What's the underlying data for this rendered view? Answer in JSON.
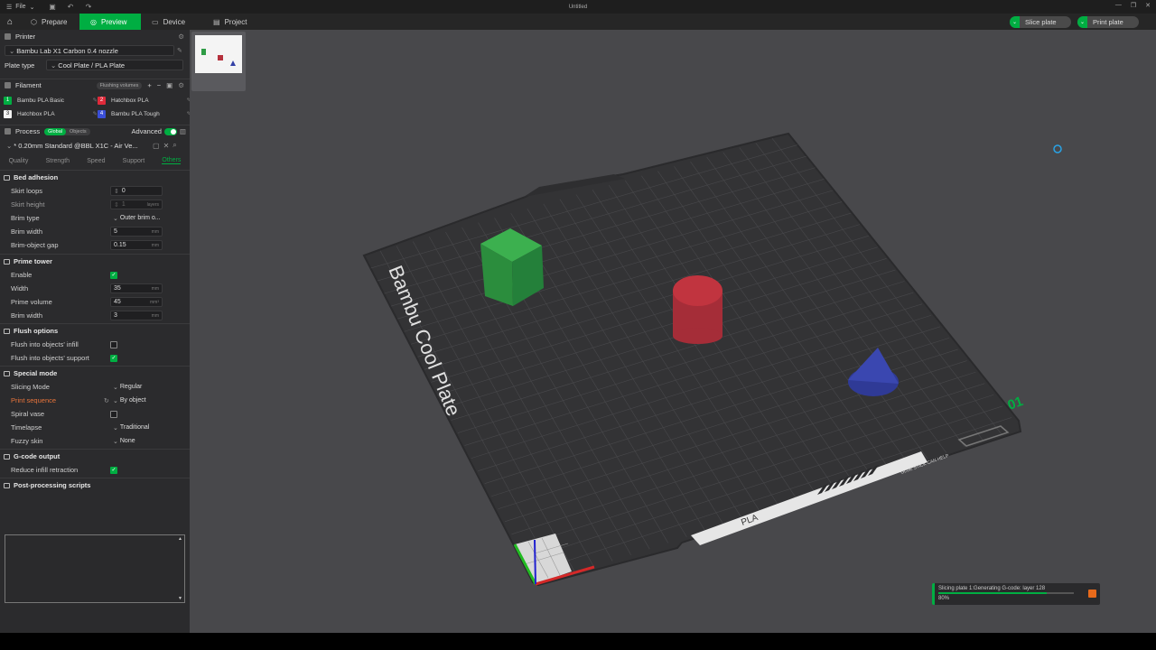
{
  "window": {
    "file_menu": "File",
    "title": "Untitled"
  },
  "topbar": {
    "tabs": [
      {
        "label": "Prepare",
        "icon": "cube-icon"
      },
      {
        "label": "Preview",
        "icon": "preview-icon",
        "active": true
      },
      {
        "label": "Device",
        "icon": "device-icon"
      },
      {
        "label": "Project",
        "icon": "project-icon"
      }
    ],
    "slice_label": "Slice plate",
    "print_label": "Print plate"
  },
  "printer": {
    "section": "Printer",
    "model": "Bambu Lab X1 Carbon 0.4 nozzle",
    "plate_type_label": "Plate type",
    "plate_type": "Cool Plate / PLA Plate"
  },
  "filament": {
    "section": "Filament",
    "flushing_label": "Flushing volumes",
    "items": [
      {
        "num": "1",
        "name": "Bambu PLA Basic",
        "color": "#00ae42"
      },
      {
        "num": "2",
        "name": "Hatchbox PLA",
        "color": "#e02a3a"
      },
      {
        "num": "3",
        "name": "Hatchbox PLA",
        "color": "#f2f2f2"
      },
      {
        "num": "4",
        "name": "Bambu PLA Tough",
        "color": "#3a4fd8"
      }
    ]
  },
  "process": {
    "section": "Process",
    "global_label": "Global",
    "objects_label": "Objects",
    "advanced_label": "Advanced",
    "preset": "* 0.20mm Standard @BBL X1C - Air Ve...",
    "tabs": [
      "Quality",
      "Strength",
      "Speed",
      "Support",
      "Others"
    ],
    "active_tab": "Others"
  },
  "groups": {
    "bed_adhesion": "Bed adhesion",
    "prime_tower": "Prime tower",
    "flush_options": "Flush options",
    "special_mode": "Special mode",
    "gcode_output": "G-code output",
    "post_processing": "Post-processing scripts"
  },
  "settings": {
    "skirt_loops": {
      "label": "Skirt loops",
      "value": "0"
    },
    "skirt_height": {
      "label": "Skirt height",
      "value": "1",
      "unit": "layers"
    },
    "brim_type": {
      "label": "Brim type",
      "value": "Outer brim o..."
    },
    "brim_width": {
      "label": "Brim width",
      "value": "5",
      "unit": "mm"
    },
    "brim_gap": {
      "label": "Brim-object gap",
      "value": "0.15",
      "unit": "mm"
    },
    "pt_enable": {
      "label": "Enable"
    },
    "pt_width": {
      "label": "Width",
      "value": "35",
      "unit": "mm"
    },
    "pt_volume": {
      "label": "Prime volume",
      "value": "45",
      "unit": "mm³"
    },
    "pt_brim": {
      "label": "Brim width",
      "value": "3",
      "unit": "mm"
    },
    "flush_infill": {
      "label": "Flush into objects' infill"
    },
    "flush_support": {
      "label": "Flush into objects' support"
    },
    "slicing_mode": {
      "label": "Slicing Mode",
      "value": "Regular"
    },
    "print_sequence": {
      "label": "Print sequence",
      "value": "By object"
    },
    "spiral_vase": {
      "label": "Spiral vase"
    },
    "timelapse": {
      "label": "Timelapse",
      "value": "Traditional"
    },
    "fuzzy_skin": {
      "label": "Fuzzy skin",
      "value": "None"
    },
    "reduce_retraction": {
      "label": "Reduce infill retraction"
    }
  },
  "plate": {
    "brand_text": "Bambu Cool Plate",
    "plate_number": "01",
    "material_text": "PLA",
    "glue_text": "GLUE STICK CAN HELP",
    "objects": [
      {
        "name": "cube",
        "color": "#2e9c45"
      },
      {
        "name": "cylinder",
        "color": "#b5303c"
      },
      {
        "name": "cone",
        "color": "#3340a6"
      }
    ]
  },
  "progress": {
    "text": "Slicing plate 1:Generating G-code: layer 128",
    "percent": "80%",
    "fraction": 0.8
  }
}
